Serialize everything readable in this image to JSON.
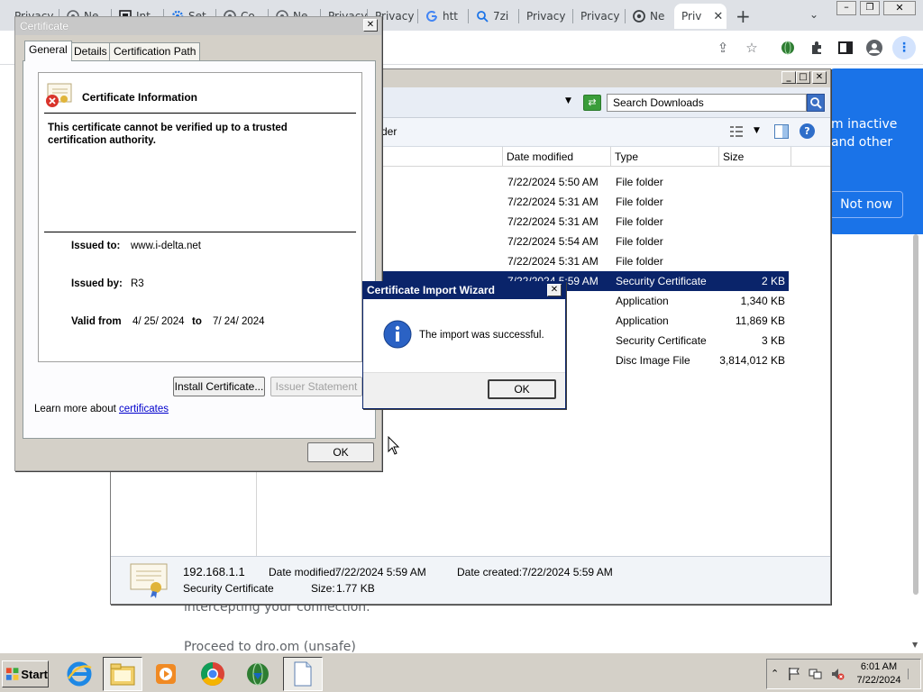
{
  "browser": {
    "tabs": [
      {
        "label": "Privacy"
      },
      {
        "label": "Ne"
      },
      {
        "label": "Int"
      },
      {
        "label": "Set"
      },
      {
        "label": "Co"
      },
      {
        "label": "Ne"
      },
      {
        "label": "Privacy"
      },
      {
        "label": "Privacy"
      },
      {
        "label": "htt"
      },
      {
        "label": "7zi"
      },
      {
        "label": "Privacy"
      },
      {
        "label": "Privacy"
      },
      {
        "label": "Ne"
      },
      {
        "label": "Priv"
      }
    ],
    "active_tab_index": 13,
    "new_tab_label": "+",
    "page": {
      "banner_text": "m inactive and other",
      "not_now_label": "Not now",
      "line1": "intercepting your connection.",
      "line2": "Proceed to dro.om (unsafe)"
    }
  },
  "explorer": {
    "search_placeholder": "Search Downloads",
    "toolbar_text": "der",
    "columns": [
      "Date modified",
      "Type",
      "Size"
    ],
    "rows": [
      {
        "date": "7/22/2024 5:50 AM",
        "type": "File folder",
        "size": ""
      },
      {
        "date": "7/22/2024 5:31 AM",
        "type": "File folder",
        "size": ""
      },
      {
        "date": "7/22/2024 5:31 AM",
        "type": "File folder",
        "size": ""
      },
      {
        "date": "7/22/2024 5:54 AM",
        "type": "File folder",
        "size": ""
      },
      {
        "date": "7/22/2024 5:31 AM",
        "type": "File folder",
        "size": ""
      },
      {
        "date": "7/22/2024 5:59 AM",
        "type": "Security Certificate",
        "size": "2 KB"
      },
      {
        "date": "24 AM",
        "type": "Application",
        "size": "1,340 KB"
      },
      {
        "date": "31 AM",
        "type": "Application",
        "size": "11,869 KB"
      },
      {
        "date": "33 AM",
        "type": "Security Certificate",
        "size": "3 KB"
      },
      {
        "date": "51 AM",
        "type": "Disc Image File",
        "size": "3,814,012 KB"
      }
    ],
    "selected_row": 5,
    "details": {
      "name": "192.168.1.1",
      "type": "Security Certificate",
      "date_modified_label": "Date modified:",
      "date_modified": "7/22/2024 5:59 AM",
      "date_created_label": "Date created:",
      "date_created": "7/22/2024 5:59 AM",
      "size_label": "Size:",
      "size": "1.77 KB"
    }
  },
  "certificate": {
    "title": "Certificate",
    "tabs": [
      "General",
      "Details",
      "Certification Path"
    ],
    "active_tab": 0,
    "info_heading": "Certificate Information",
    "warning": "This certificate cannot be verified up to a trusted certification authority.",
    "issued_to_label": "Issued to:",
    "issued_to": "www.i-delta.net",
    "issued_by_label": "Issued by:",
    "issued_by": "R3",
    "valid_from_label": "Valid from",
    "valid_from": "4/ 25/ 2024",
    "to_label": "to",
    "valid_to": "7/ 24/ 2024",
    "install_button": "Install Certificate...",
    "issuer_statement_button": "Issuer Statement",
    "learn_more_prefix": "Learn more about",
    "learn_more_link": "certificates",
    "ok_button": "OK"
  },
  "wizard": {
    "title": "Certificate Import Wizard",
    "message": "The import was successful.",
    "ok_button": "OK"
  },
  "taskbar": {
    "start_label": "Start",
    "time": "6:01 AM",
    "date": "7/22/2024"
  },
  "colors": {
    "selection": "#0a246a",
    "chrome_blue": "#1a73e8",
    "dialog_gray": "#d4d0c8"
  }
}
